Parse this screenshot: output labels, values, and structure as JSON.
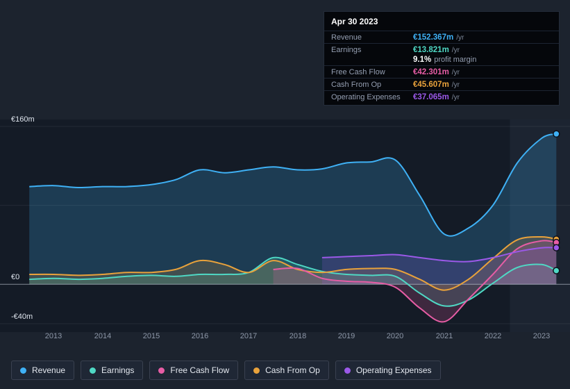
{
  "tooltip": {
    "date": "Apr 30 2023",
    "rows": [
      {
        "label": "Revenue",
        "value": "€152.367m",
        "suffix": "/yr",
        "color": "#3fb1f5"
      },
      {
        "label": "Earnings",
        "value": "€13.821m",
        "suffix": "/yr",
        "color": "#4fd8c4",
        "extra": {
          "value": "9.1%",
          "label": "profit margin"
        }
      },
      {
        "label": "Free Cash Flow",
        "value": "€42.301m",
        "suffix": "/yr",
        "color": "#e75da5"
      },
      {
        "label": "Cash From Op",
        "value": "€45.607m",
        "suffix": "/yr",
        "color": "#e9a23b"
      },
      {
        "label": "Operating Expenses",
        "value": "€37.065m",
        "suffix": "/yr",
        "color": "#9b59e8"
      }
    ]
  },
  "legend": [
    {
      "label": "Revenue",
      "color": "#3fb1f5"
    },
    {
      "label": "Earnings",
      "color": "#4fd8c4"
    },
    {
      "label": "Free Cash Flow",
      "color": "#e75da5"
    },
    {
      "label": "Cash From Op",
      "color": "#e9a23b"
    },
    {
      "label": "Operating Expenses",
      "color": "#9b59e8"
    }
  ],
  "chart_data": {
    "type": "area",
    "title": "Revenue & expenses history (EUR millions per year)",
    "x": [
      2012.5,
      2013,
      2013.5,
      2014,
      2014.5,
      2015,
      2015.5,
      2016,
      2016.5,
      2017,
      2017.5,
      2018,
      2018.5,
      2019,
      2019.5,
      2020,
      2020.5,
      2021,
      2021.5,
      2022,
      2022.5,
      2023,
      2023.3
    ],
    "series": [
      {
        "name": "Revenue",
        "color": "#3fb1f5",
        "fill_opacity": 0.22,
        "values": [
          99,
          100,
          98,
          99,
          99,
          101,
          106,
          116,
          113,
          116,
          119,
          116,
          117,
          123,
          124,
          126,
          90,
          51,
          57,
          80,
          123,
          148,
          152.37
        ]
      },
      {
        "name": "Earnings",
        "color": "#4fd8c4",
        "fill_opacity": 0.18,
        "values": [
          5,
          6,
          5,
          6,
          8,
          9,
          8,
          10,
          10,
          12,
          27,
          20,
          13,
          10,
          9,
          8,
          -9,
          -22,
          -16,
          1,
          17,
          20,
          13.82
        ]
      },
      {
        "name": "Cash From Op",
        "color": "#e9a23b",
        "fill_opacity": 0.18,
        "values": [
          10,
          10,
          9,
          10,
          12,
          12,
          15,
          24,
          20,
          12,
          24,
          15,
          12,
          15,
          16,
          15,
          5,
          -6,
          5,
          26,
          45,
          48,
          45.61
        ]
      },
      {
        "name": "Free Cash Flow",
        "color": "#e75da5",
        "fill_opacity": 0.2,
        "values": [
          null,
          null,
          null,
          null,
          null,
          null,
          null,
          null,
          null,
          null,
          15,
          16,
          6,
          3,
          2,
          -3,
          -24,
          -38,
          -15,
          10,
          36,
          44,
          42.3
        ]
      },
      {
        "name": "Operating Expenses",
        "color": "#9b59e8",
        "fill_opacity": 0.18,
        "values": [
          null,
          null,
          null,
          null,
          null,
          null,
          null,
          null,
          null,
          null,
          null,
          null,
          27,
          28,
          29,
          30,
          27,
          24,
          23,
          27,
          33,
          37,
          37.07
        ]
      }
    ],
    "xlim": [
      2011.9,
      2023.58
    ],
    "ylim": [
      -40,
      160
    ],
    "yticks": [
      {
        "value": 160,
        "label": "€160m"
      },
      {
        "value": 0,
        "label": "€0"
      },
      {
        "value": -40,
        "label": "-€40m"
      }
    ],
    "gridlines": [
      160,
      80,
      0,
      -40
    ],
    "xticks": [
      2013,
      2014,
      2015,
      2016,
      2017,
      2018,
      2019,
      2020,
      2021,
      2022,
      2023
    ],
    "highlight_band": {
      "from": 2022.35,
      "to": 2023.58
    },
    "legend_position": "bottom",
    "grid": true
  }
}
